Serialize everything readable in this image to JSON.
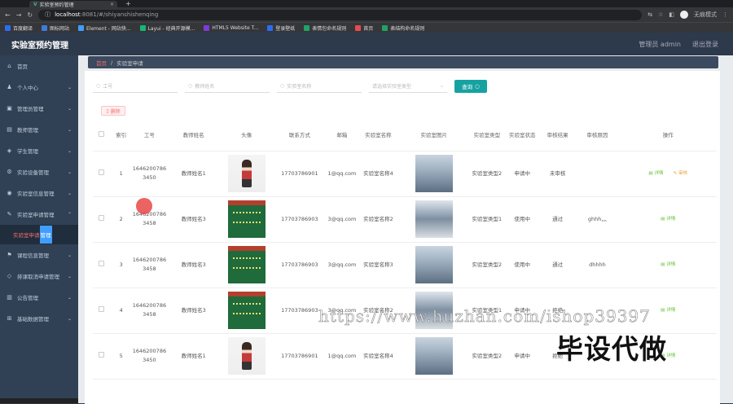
{
  "browser": {
    "tab_title": "实验室预约管理",
    "url_host": "localhost",
    "url_path": ":8081/#/shiyanshishenqing",
    "profile_label": "无痕模式",
    "bookmarks": [
      {
        "label": "百度翻译",
        "color": "#2a6df4"
      },
      {
        "label": "图标网站",
        "color": "#3b7dd8"
      },
      {
        "label": "Element - 网站快...",
        "color": "#409eff"
      },
      {
        "label": "Layui - 经典开源模...",
        "color": "#16b777"
      },
      {
        "label": "HTML5 Website T...",
        "color": "#7d3bd8"
      },
      {
        "label": "登录壁纸",
        "color": "#2a6df4"
      },
      {
        "label": "表情包命名规则",
        "color": "#21a366"
      },
      {
        "label": "首页",
        "color": "#e34d4d"
      },
      {
        "label": "表结构命名规则",
        "color": "#21a366"
      }
    ]
  },
  "app": {
    "title": "实验室预约管理",
    "header": {
      "user": "管理员 admin",
      "logout": "退出登录"
    },
    "menu": [
      {
        "label": "首页",
        "icon": "home-icon",
        "glyph": "⌂",
        "arrow": ""
      },
      {
        "label": "个人中心",
        "icon": "user-icon",
        "glyph": "♟",
        "arrow": "⌄"
      },
      {
        "label": "管理员管理",
        "icon": "admin-icon",
        "glyph": "▣",
        "arrow": "⌄"
      },
      {
        "label": "教师管理",
        "icon": "teacher-icon",
        "glyph": "▤",
        "arrow": "⌄"
      },
      {
        "label": "学生管理",
        "icon": "student-icon",
        "glyph": "◈",
        "arrow": "⌄"
      },
      {
        "label": "实验设备管理",
        "icon": "device-icon",
        "glyph": "⚙",
        "arrow": "⌄"
      },
      {
        "label": "实验室信息管理",
        "icon": "lab-info-icon",
        "glyph": "◉",
        "arrow": "⌄"
      },
      {
        "label": "实验室申请管理",
        "icon": "lab-apply-icon",
        "glyph": "✎",
        "arrow": "⌃"
      }
    ],
    "submenu_active": {
      "prefix": "实验室申请",
      "highlight": "管理"
    },
    "menu_after": [
      {
        "label": "课程信息管理",
        "icon": "course-icon",
        "glyph": "⚑",
        "arrow": "⌄"
      },
      {
        "label": "排课取消申请管理",
        "icon": "cancel-icon",
        "glyph": "◇",
        "arrow": "⌄"
      },
      {
        "label": "公告管理",
        "icon": "notice-icon",
        "glyph": "▥",
        "arrow": "⌄"
      },
      {
        "label": "基础数据管理",
        "icon": "base-data-icon",
        "glyph": "⊞",
        "arrow": "⌄"
      }
    ],
    "breadcrumb": {
      "home": "首页",
      "current": "实验室申请"
    },
    "filters": {
      "job_no": "工号",
      "teacher_name": "教师姓名",
      "lab_name": "实验室名称",
      "lab_type": "请选择实验室类型",
      "query": "查询"
    },
    "delete_label": "删除",
    "columns": [
      "索引",
      "工号",
      "教师姓名",
      "头像",
      "联系方式",
      "邮箱",
      "实验室名称",
      "实验室图片",
      "实验室类型",
      "实验室状态",
      "审核结果",
      "审核原因",
      "操作"
    ],
    "rows": [
      {
        "idx": "1",
        "job": "16462007863450",
        "name": "教师姓名1",
        "avatar": "teacher",
        "phone": "17703786901",
        "email": "1@qq.com",
        "lab": "实验室名称4",
        "img": "lab",
        "type": "实验室类型2",
        "status": "申请中",
        "result": "未审核",
        "reason": "",
        "detail": "详情",
        "audit": "审核"
      },
      {
        "idx": "2",
        "job": "16462007863458",
        "name": "教师姓名3",
        "avatar": "board",
        "phone": "17703786903",
        "email": "3@qq.com",
        "lab": "实验室名称2",
        "img": "lab2",
        "type": "实验室类型1",
        "status": "使用中",
        "result": "通过",
        "reason": "ghhh灬",
        "detail": "详情",
        "audit": ""
      },
      {
        "idx": "3",
        "job": "16462007863458",
        "name": "教师姓名3",
        "avatar": "board",
        "phone": "17703786903",
        "email": "3@qq.com",
        "lab": "实验室名称3",
        "img": "lab",
        "type": "实验室类型2",
        "status": "使用中",
        "result": "通过",
        "reason": "dhhhh",
        "detail": "详情",
        "audit": ""
      },
      {
        "idx": "4",
        "job": "16462007863458",
        "name": "教师姓名3",
        "avatar": "board",
        "phone": "17703786903",
        "email": "3@qq.com",
        "lab": "实验室名称2",
        "img": "lab2",
        "type": "实验室类型1",
        "status": "申请中",
        "result": "拒绝",
        "reason": "",
        "detail": "详情",
        "audit": ""
      },
      {
        "idx": "5",
        "job": "16462007863450",
        "name": "教师姓名1",
        "avatar": "teacher",
        "phone": "17703786901",
        "email": "1@qq.com",
        "lab": "实验室名称4",
        "img": "lab",
        "type": "实验室类型2",
        "status": "申请中",
        "result": "拒绝",
        "reason": "",
        "detail": "详情",
        "audit": ""
      }
    ],
    "watermark": "https://www.huzhan.com/ishop39397",
    "watermark2": "毕设代做"
  }
}
